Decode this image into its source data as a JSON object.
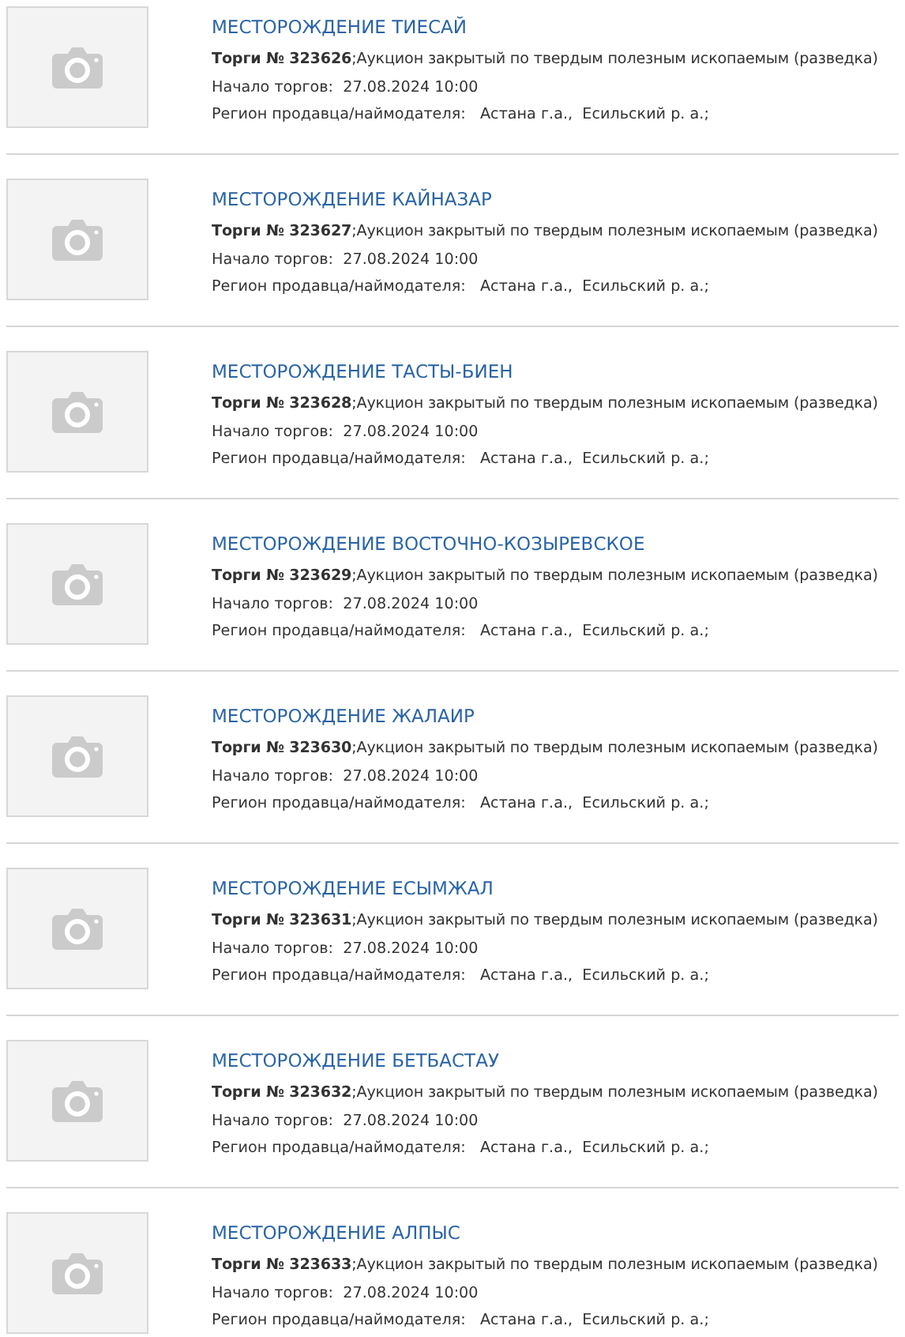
{
  "listings": [
    {
      "thumbnail": {
        "kind": "placeholder"
      },
      "title": "МЕСТОРОЖДЕНИЕ ТИЕСАЙ",
      "lot": "**Торги № 323626**;Аукцион закрытый по твердым полезным ископаемым (разведка)",
      "start": "Начало торгов:  27.08.2024 10:00",
      "region": "Регион продавца/наймодателя:   Астана г.а.,  Есильский р. а.;"
    },
    {
      "thumbnail": {
        "kind": "placeholder"
      },
      "title": "МЕСТОРОЖДЕНИЕ КАЙНАЗАР",
      "lot": "**Торги № 323627**;Аукцион закрытый по твердым полезным ископаемым (разведка)",
      "start": "Начало торгов:  27.08.2024 10:00",
      "region": "Регион продавца/наймодателя:   Астана г.а.,  Есильский р. а.;"
    },
    {
      "thumbnail": {
        "kind": "placeholder"
      },
      "title": "МЕСТОРОЖДЕНИЕ ТАСТЫ-БИЕН",
      "lot": "**Торги № 323628**;Аукцион закрытый по твердым полезным ископаемым (разведка)",
      "start": "Начало торгов:  27.08.2024 10:00",
      "region": "Регион продавца/наймодателя:   Астана г.а.,  Есильский р. а.;"
    },
    {
      "thumbnail": {
        "kind": "placeholder"
      },
      "title": "МЕСТОРОЖДЕНИЕ ВОСТОЧНО-КОЗЫРЕВСКОЕ",
      "lot": "**Торги № 323629**;Аукцион закрытый по твердым полезным ископаемым (разведка)",
      "start": "Начало торгов:  27.08.2024 10:00",
      "region": "Регион продавца/наймодателя:   Астана г.а.,  Есильский р. а.;"
    },
    {
      "thumbnail": {
        "kind": "placeholder"
      },
      "title": "МЕСТОРОЖДЕНИЕ ЖАЛАИР",
      "lot": "**Торги № 323630**;Аукцион закрытый по твердым полезным ископаемым (разведка)",
      "start": "Начало торгов:  27.08.2024 10:00",
      "region": "Регион продавца/наймодателя:   Астана г.а.,  Есильский р. а.;"
    },
    {
      "thumbnail": {
        "kind": "placeholder"
      },
      "title": "МЕСТОРОЖДЕНИЕ ЕСЫМЖАЛ",
      "lot": "**Торги № 323631**;Аукцион закрытый по твердым полезным ископаемым (разведка)",
      "start": "Начало торгов:  27.08.2024 10:00",
      "region": "Регион продавца/наймодателя:   Астана г.а.,  Есильский р. а.;"
    },
    {
      "thumbnail": {
        "kind": "placeholder"
      },
      "title": "МЕСТОРОЖДЕНИЕ БЕТБАСТАУ",
      "lot": "**Торги № 323632**;Аукцион закрытый по твердым полезным ископаемым (разведка)",
      "start": "Начало торгов:  27.08.2024 10:00",
      "region": "Регион продавца/наймодателя:   Астана г.а.,  Есильский р. а.;"
    },
    {
      "thumbnail": {
        "kind": "placeholder"
      },
      "title": "МЕСТОРОЖДЕНИЕ АЛПЫС",
      "lot": "**Торги № 323633**;Аукцион закрытый по твердым полезным ископаемым (разведка)",
      "start": "Начало торгов:  27.08.2024 10:00",
      "region": "Регион продавца/наймодателя:   Астана г.а.,  Есильский р. а.;"
    }
  ]
}
